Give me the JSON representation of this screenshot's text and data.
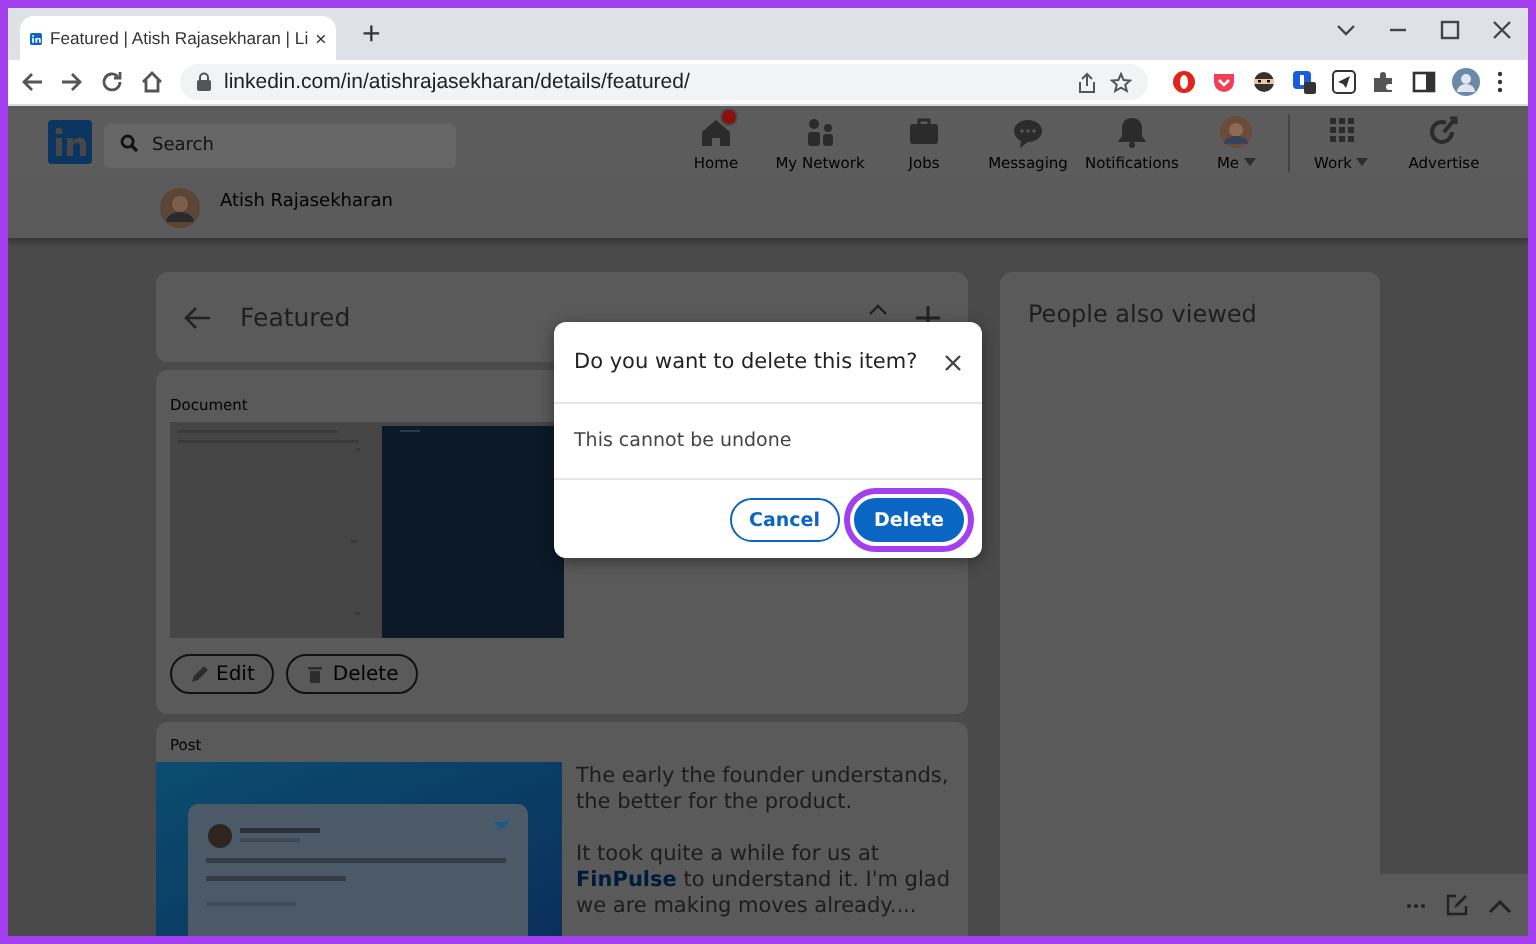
{
  "browser": {
    "tab": {
      "title": "Featured | Atish Rajasekharan | Li",
      "selected": true
    },
    "new_tab": "+",
    "url": "linkedin.com/in/atishrajasekharan/details/featured/"
  },
  "nav": {
    "search": {
      "placeholder": "Search"
    },
    "items": [
      {
        "label": "Home",
        "notification": true,
        "dropdown": false
      },
      {
        "label": "My Network",
        "notification": false,
        "dropdown": false
      },
      {
        "label": "Jobs",
        "notification": false,
        "dropdown": false
      },
      {
        "label": "Messaging",
        "notification": false,
        "dropdown": false
      },
      {
        "label": "Notifications",
        "notification": false,
        "dropdown": false
      },
      {
        "label": "Me",
        "notification": false,
        "dropdown": true
      },
      {
        "label": "Work",
        "notification": false,
        "dropdown": true
      },
      {
        "label": "Advertise",
        "notification": false,
        "dropdown": false
      }
    ]
  },
  "profile": {
    "name": "Atish Rajasekharan"
  },
  "featured": {
    "title": "Featured",
    "items": [
      {
        "kind": "document",
        "type_label": "Document",
        "actions": [
          "Edit",
          "Delete"
        ]
      },
      {
        "kind": "post",
        "type_label": "Post",
        "paragraphs": [
          {
            "text": "The early the founder understands, the better for the product."
          },
          {
            "text": "It took quite a while for us at ",
            "link": "FinPulse",
            "after": " to understand it. I'm glad we are making moves already...."
          }
        ]
      }
    ]
  },
  "sidebar": {
    "title": "People also viewed"
  },
  "dialog": {
    "title": "Do you want to delete this item?",
    "message": "This cannot be undone",
    "buttons": [
      {
        "label": "Cancel",
        "kind": "secondary",
        "highlighted": false
      },
      {
        "label": "Delete",
        "kind": "primary",
        "highlighted": true
      }
    ]
  }
}
